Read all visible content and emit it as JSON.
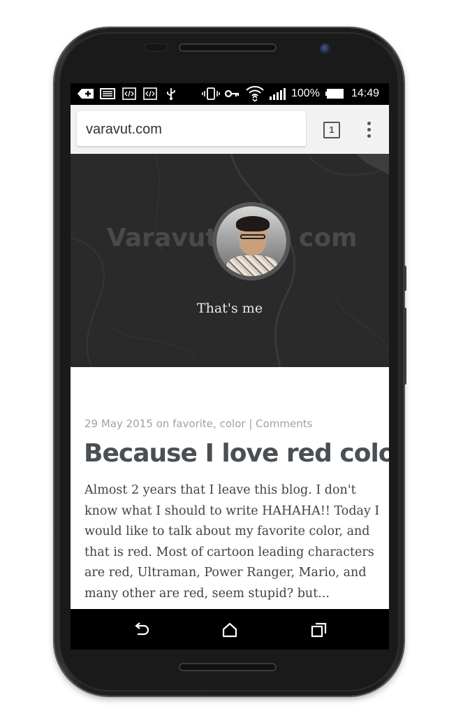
{
  "status_bar": {
    "battery": "100%",
    "time": "14:49",
    "icons": [
      "dismiss-icon",
      "image-icon",
      "code-icon",
      "code-icon",
      "usb-icon",
      "vibrate-icon",
      "key-icon",
      "wifi-icon",
      "signal-icon",
      "battery-icon"
    ]
  },
  "browser": {
    "url": "varavut.com",
    "tab_count": "1",
    "menu_icon": "overflow-menu-icon"
  },
  "hero": {
    "logo_left": "Varavut",
    "logo_right": "com",
    "caption": "That's me"
  },
  "post": {
    "date": "29 May 2015",
    "on_word": "on",
    "tag1": "favorite",
    "tag2": "color",
    "separator": "|",
    "comments_link": "Comments",
    "title": "Because I love red color",
    "excerpt": "Almost 2 years that I leave this blog. I don't know what I should to write HAHAHA!! Today I would like to talk about my favorite color, and that is red. Most of cartoon leading characters are red, Ultraman, Power Ranger, Mario, and many other are red, seem stupid? but..."
  },
  "navbar": {
    "back_icon": "back-icon",
    "home_icon": "home-icon",
    "recents_icon": "recents-icon"
  },
  "colors": {
    "hero_bg": "#2a2a2a",
    "title": "#4a4f54",
    "meta": "#9aa3a8"
  }
}
